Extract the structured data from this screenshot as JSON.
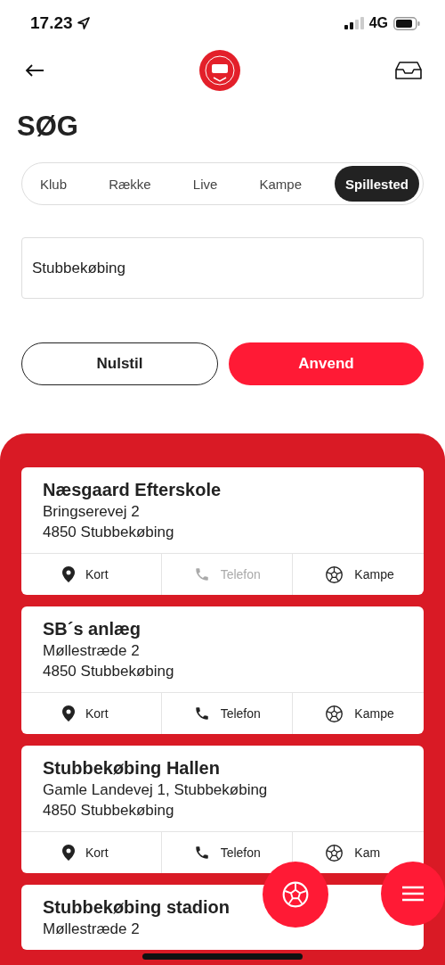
{
  "status_bar": {
    "time": "17.23",
    "network": "4G"
  },
  "page_title": "SØG",
  "tabs": [
    {
      "label": "Klub",
      "selected": false
    },
    {
      "label": "Række",
      "selected": false
    },
    {
      "label": "Live",
      "selected": false
    },
    {
      "label": "Kampe",
      "selected": false
    },
    {
      "label": "Spillested",
      "selected": true
    }
  ],
  "search": {
    "value": "Stubbekøbing"
  },
  "buttons": [
    {
      "label": "Nulstil",
      "kind": "outline"
    },
    {
      "label": "Anvend",
      "kind": "primary"
    }
  ],
  "venues": [
    {
      "name": "Næsgaard Efterskole",
      "address": [
        "Bringserevej 2",
        "4850 Stubbekøbing"
      ],
      "actions": [
        {
          "kind": "map",
          "label": "Kort",
          "disabled": false
        },
        {
          "kind": "phone",
          "label": "Telefon",
          "disabled": true
        },
        {
          "kind": "matches",
          "label": "Kampe",
          "disabled": false
        }
      ]
    },
    {
      "name": "SB´s anlæg",
      "address": [
        "Møllestræde 2",
        "4850 Stubbekøbing"
      ],
      "actions": [
        {
          "kind": "map",
          "label": "Kort",
          "disabled": false
        },
        {
          "kind": "phone",
          "label": "Telefon",
          "disabled": false
        },
        {
          "kind": "matches",
          "label": "Kampe",
          "disabled": false
        }
      ]
    },
    {
      "name": "Stubbekøbing Hallen",
      "address": [
        "Gamle Landevej 1, Stubbekøbing",
        "4850 Stubbekøbing"
      ],
      "actions": [
        {
          "kind": "map",
          "label": "Kort",
          "disabled": false
        },
        {
          "kind": "phone",
          "label": "Telefon",
          "disabled": false
        },
        {
          "kind": "matches",
          "label": "Kam",
          "disabled": false
        }
      ]
    },
    {
      "name": "Stubbekøbing stadion",
      "address": [
        "Møllestræde 2"
      ]
    }
  ]
}
